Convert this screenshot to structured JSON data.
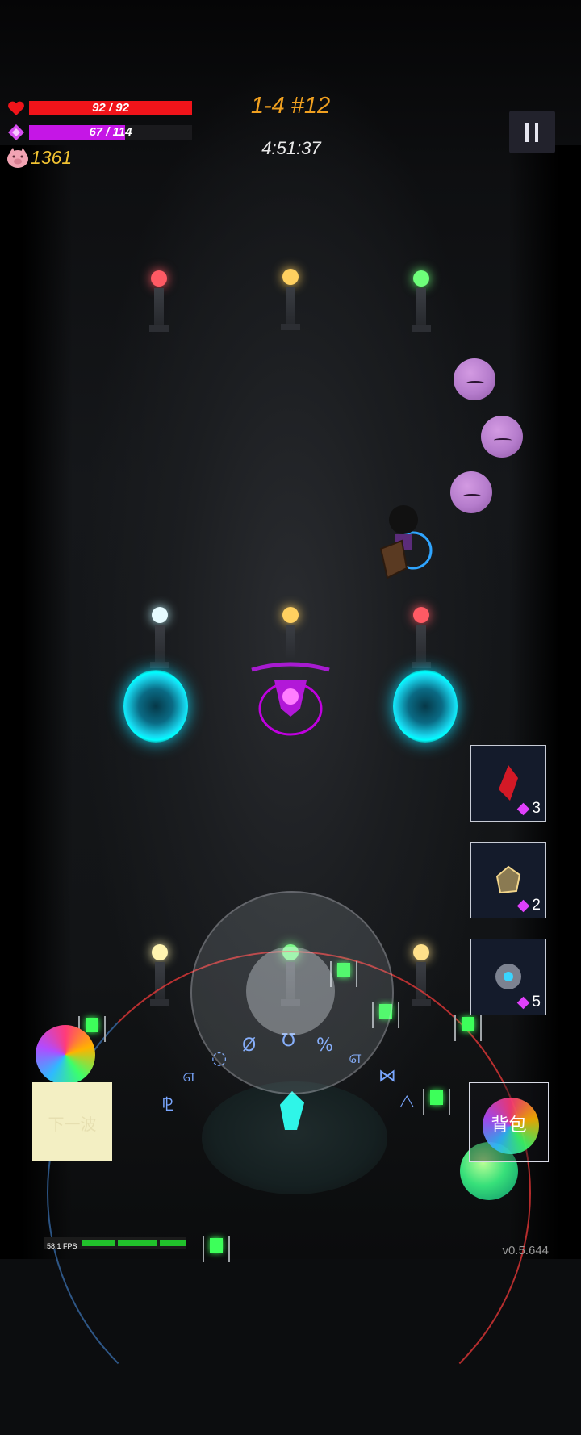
{
  "hud": {
    "hp": {
      "current": 92,
      "max": 92,
      "label": "92 / 92",
      "color": "#f0141a"
    },
    "mp": {
      "current": 67,
      "max": 114,
      "label": "67 / 114",
      "color": "#c516e6"
    },
    "coins": "1361",
    "stage": "1-4 #12",
    "timer": "4:51:37"
  },
  "icons": {
    "hp": "heart-icon",
    "mp": "diamond-icon",
    "coins": "pig-icon",
    "pause": "pause-icon"
  },
  "skills": [
    {
      "name": "red-crystal",
      "cost": "3"
    },
    {
      "name": "golden-cube",
      "cost": "2"
    },
    {
      "name": "rock-orb",
      "cost": "5"
    }
  ],
  "buttons": {
    "next_wave": "下一波",
    "bag": "背包"
  },
  "runes": [
    "⅊",
    "௭",
    "◌",
    "Ø",
    "℧",
    "%",
    "௭",
    "⋈",
    "⧍"
  ],
  "footer": {
    "fps": "58.1 FPS",
    "version": "v0.5.644"
  }
}
